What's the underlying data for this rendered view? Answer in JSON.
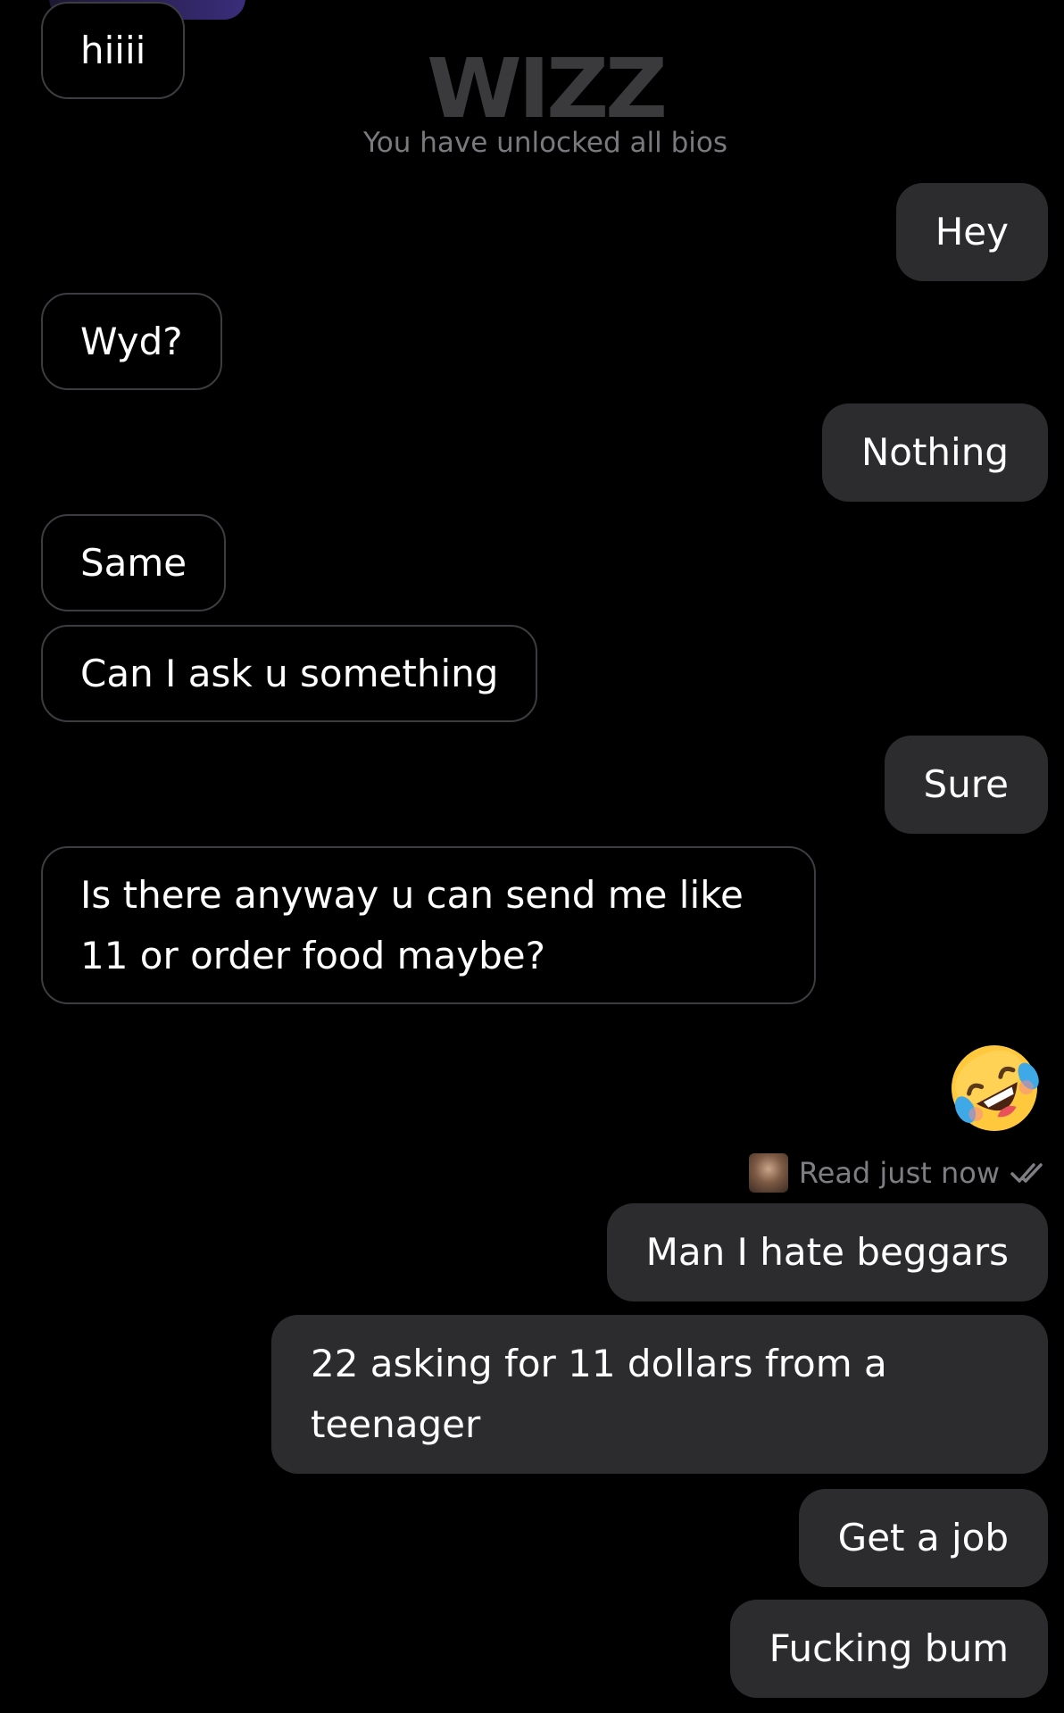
{
  "app": {
    "logo_text": "WIZZ",
    "unlocked_text": "You have unlocked all bios"
  },
  "messages": [
    {
      "side": "in",
      "text": "hiiii"
    },
    {
      "side": "out",
      "text": "Hey"
    },
    {
      "side": "in",
      "text": "Wyd?"
    },
    {
      "side": "out",
      "text": "Nothing"
    },
    {
      "side": "in",
      "text": "Same"
    },
    {
      "side": "in",
      "text": "Can I ask u something"
    },
    {
      "side": "out",
      "text": "Sure"
    },
    {
      "side": "in",
      "text": "Is there anyway u can send me like 11 or order food maybe?"
    },
    {
      "side": "out",
      "text": "🤣"
    },
    {
      "side": "out",
      "text": "Man I hate beggars"
    },
    {
      "side": "out",
      "text": "22 asking for 11 dollars from a teenager"
    },
    {
      "side": "out",
      "text": "Get a job"
    },
    {
      "side": "out",
      "text": "Fucking bum"
    }
  ],
  "read_receipt": {
    "text": "Read just now",
    "icon": "double-check-icon"
  },
  "colors": {
    "background": "#000000",
    "outgoing_bubble": "#2c2c2f",
    "incoming_border": "#3d3d41",
    "muted_text": "#7d7d82",
    "logo": "#3a3a3d"
  }
}
